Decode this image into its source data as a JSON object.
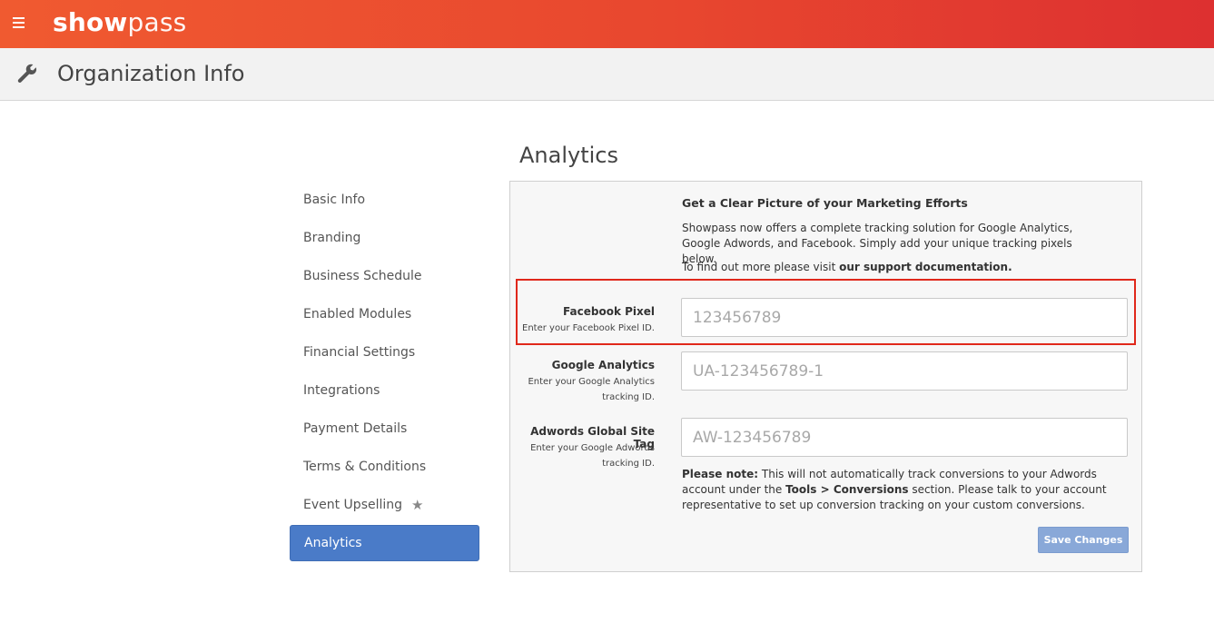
{
  "header": {
    "menu_icon": "hamburger-menu-icon",
    "logo_bold": "show",
    "logo_light": "pass",
    "brand_color": "#e8472f"
  },
  "subheader": {
    "icon": "wrench-icon",
    "title": "Organization Info"
  },
  "sidebar": {
    "items": [
      {
        "label": "Basic Info"
      },
      {
        "label": "Branding"
      },
      {
        "label": "Business Schedule"
      },
      {
        "label": "Enabled Modules"
      },
      {
        "label": "Financial Settings"
      },
      {
        "label": "Integrations"
      },
      {
        "label": "Payment Details"
      },
      {
        "label": "Terms & Conditions"
      },
      {
        "label": "Event Upselling",
        "icon": "star-icon"
      },
      {
        "label": "Analytics",
        "active": true
      }
    ],
    "active_color": "#4a7bc8"
  },
  "main": {
    "title": "Analytics",
    "intro": {
      "heading": "Get a Clear Picture of your Marketing Efforts",
      "text": "Showpass now offers a complete tracking solution for Google Analytics, Google Adwords, and Facebook. Simply add your unique tracking pixels below.",
      "link_prefix": "To find out more please visit ",
      "link_text": "our support documentation."
    },
    "fields": {
      "facebook": {
        "label": "Facebook Pixel",
        "help": "Enter your Facebook Pixel ID.",
        "placeholder": "123456789",
        "value": ""
      },
      "google": {
        "label": "Google Analytics",
        "help": "Enter your Google Analytics tracking ID.",
        "placeholder": "UA-123456789-1",
        "value": ""
      },
      "adwords": {
        "label": "Adwords Global Site Tag",
        "help": "Enter your Google Adwords tracking ID.",
        "placeholder": "AW-123456789",
        "value": ""
      }
    },
    "note": {
      "label": "Please note:",
      "text1": " This will not automatically track conversions to your Adwords account under the ",
      "bold": "Tools > Conversions",
      "text2": " section. Please talk to your account representative to set up conversion tracking on your custom conversions."
    },
    "save_label": "Save Changes",
    "highlight_color": "#e0281b"
  }
}
